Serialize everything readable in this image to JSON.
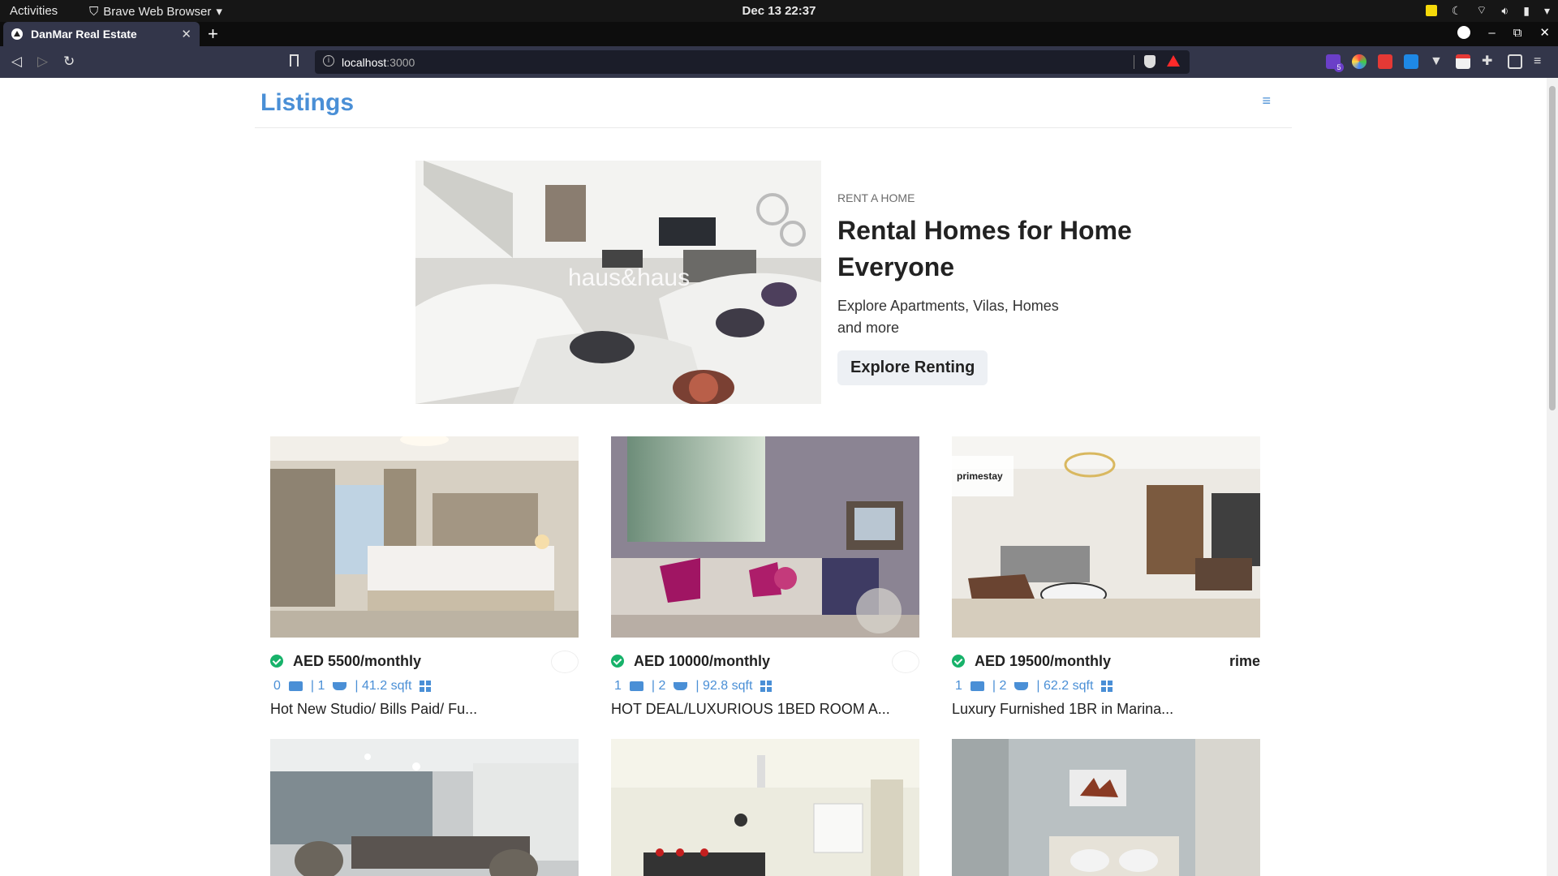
{
  "system_bar": {
    "activities": "Activities",
    "app_name": "Brave Web Browser",
    "clock": "Dec 13  22:37"
  },
  "browser": {
    "tab_title": "DanMar Real Estate",
    "url_host": "localhost",
    "url_port": ":3000",
    "extension_badge": "5"
  },
  "page": {
    "logo": "Listings",
    "hero": {
      "eyebrow": "RENT A HOME",
      "title": "Rental Homes for Home Everyone",
      "description": "Explore Apartments, Vilas, Homes and more",
      "cta": "Explore Renting",
      "watermark": "haus&haus"
    },
    "listings": [
      {
        "price": "AED 5500/monthly",
        "beds": "0",
        "baths": "| 1",
        "area": "| 41.2 sqft",
        "title": "Hot New Studio/ Bills Paid/ Fu...",
        "agency": ""
      },
      {
        "price": "AED 10000/monthly",
        "beds": "1",
        "baths": "| 2",
        "area": "| 92.8 sqft",
        "title": "HOT DEAL/LUXURIOUS 1BED ROOM A...",
        "agency": ""
      },
      {
        "price": "AED 19500/monthly",
        "beds": "1",
        "baths": "| 2",
        "area": "| 62.2 sqft",
        "title": "Luxury Furnished 1BR in Marina...",
        "agency": "rime",
        "photo_badge": "primestay"
      }
    ]
  },
  "colors": {
    "accent": "#4a8fd6",
    "verified": "#17b26a",
    "browser_chrome": "#33364a"
  }
}
